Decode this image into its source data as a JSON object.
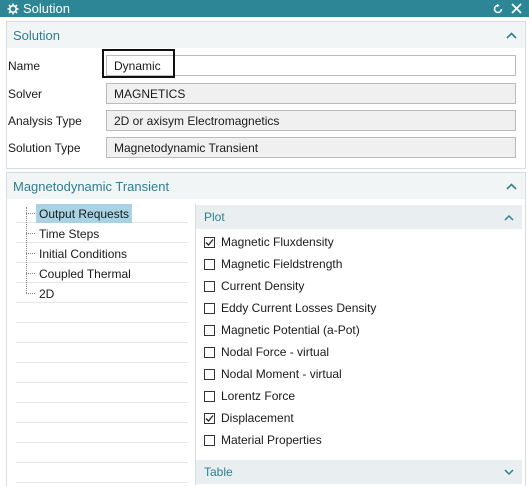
{
  "window": {
    "title": "Solution",
    "icon": "gear-icon",
    "reset_icon": "reset-icon",
    "close_icon": "close-icon"
  },
  "solution": {
    "header": "Solution",
    "name_label": "Name",
    "name_value": "Dynamic",
    "solver_label": "Solver",
    "solver_value": "MAGNETICS",
    "analysis_label": "Analysis Type",
    "analysis_value": "2D or axisym Electromagnetics",
    "solution_type_label": "Solution Type",
    "solution_type_value": "Magnetodynamic Transient"
  },
  "transient": {
    "header": "Magnetodynamic Transient",
    "tree": [
      "Output Requests",
      "Time Steps",
      "Initial Conditions",
      "Coupled Thermal",
      "2D"
    ],
    "selected_index": 0,
    "plot_header": "Plot",
    "plot_items": [
      {
        "label": "Magnetic Fluxdensity",
        "checked": true
      },
      {
        "label": "Magnetic Fieldstrength",
        "checked": false
      },
      {
        "label": "Current Density",
        "checked": false
      },
      {
        "label": "Eddy Current Losses Density",
        "checked": false
      },
      {
        "label": "Magnetic Potential (a-Pot)",
        "checked": false
      },
      {
        "label": "Nodal Force - virtual",
        "checked": false
      },
      {
        "label": "Nodal Moment - virtual",
        "checked": false
      },
      {
        "label": "Lorentz Force",
        "checked": false
      },
      {
        "label": "Displacement",
        "checked": true
      },
      {
        "label": "Material Properties",
        "checked": false
      }
    ],
    "table_header": "Table"
  },
  "colors": {
    "accent": "#2d8696",
    "header_text": "#2d7f90",
    "selection": "#a9d3e4"
  }
}
